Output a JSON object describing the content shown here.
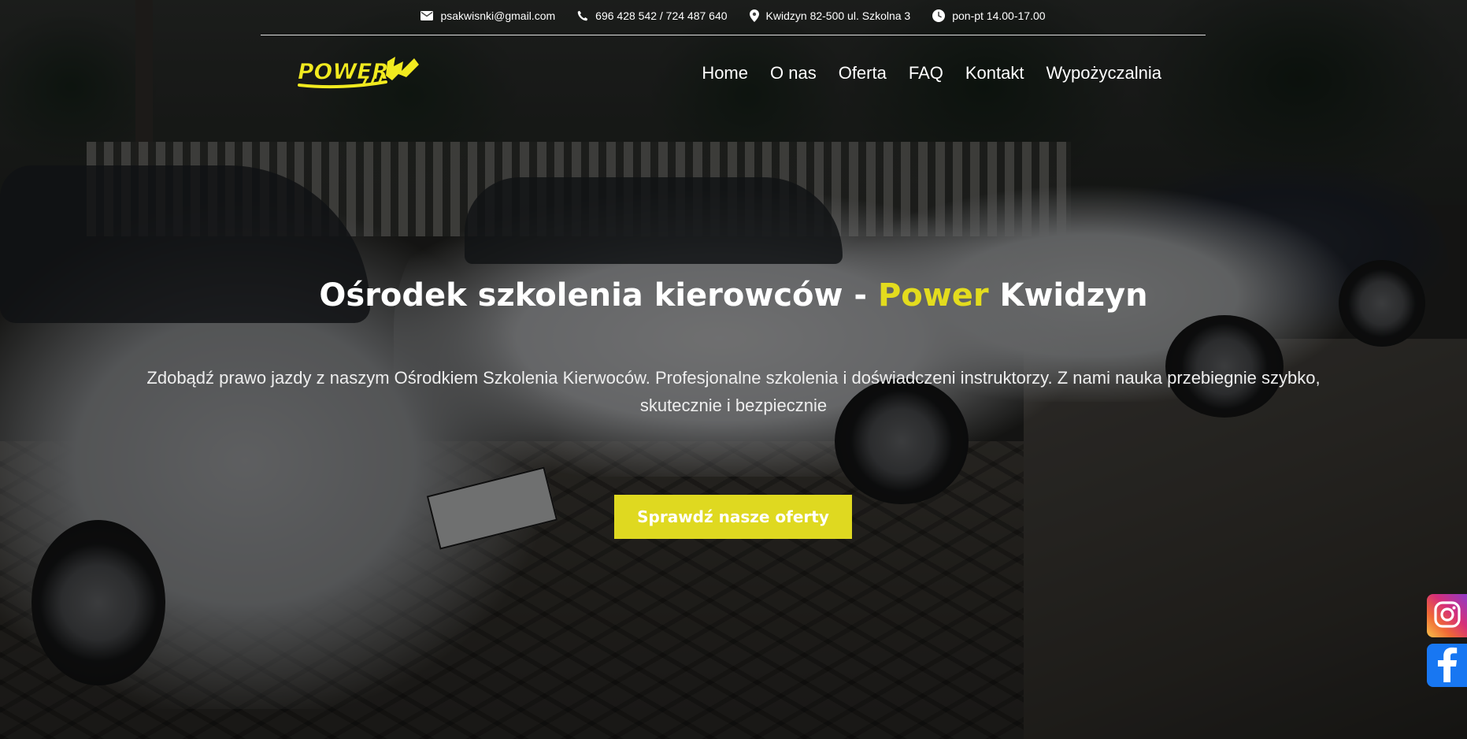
{
  "topbar": {
    "email": "psakwisnki@gmail.com",
    "phone": "696 428 542 / 724 487 640",
    "address": "Kwidzyn 82-500 ul. Szkolna 3",
    "hours": "pon-pt 14.00-17.00"
  },
  "logo": {
    "text": "POWER"
  },
  "nav": {
    "items": [
      "Home",
      "O nas",
      "Oferta",
      "FAQ",
      "Kontakt",
      "Wypożyczalnia"
    ]
  },
  "hero": {
    "title_prefix": "Ośrodek szkolenia kierowców - ",
    "title_accent": "Power",
    "title_suffix": " Kwidzyn",
    "description": "Zdobądź prawo jazdy z naszym Ośrodkiem Szkolenia Kierwoców. Profesjonalne szkolenia i doświadczeni instruktorzy. Z nami nauka przebiegnie szybko, skutecznie i bezpiecznie",
    "cta_label": "Sprawdź nasze oferty"
  },
  "social": {
    "icons": [
      "instagram-icon",
      "facebook-icon"
    ]
  },
  "colors": {
    "accent": "#e3dc1e",
    "button": "#dfd920",
    "instagram": "#d62f78",
    "facebook": "#1877f2"
  }
}
